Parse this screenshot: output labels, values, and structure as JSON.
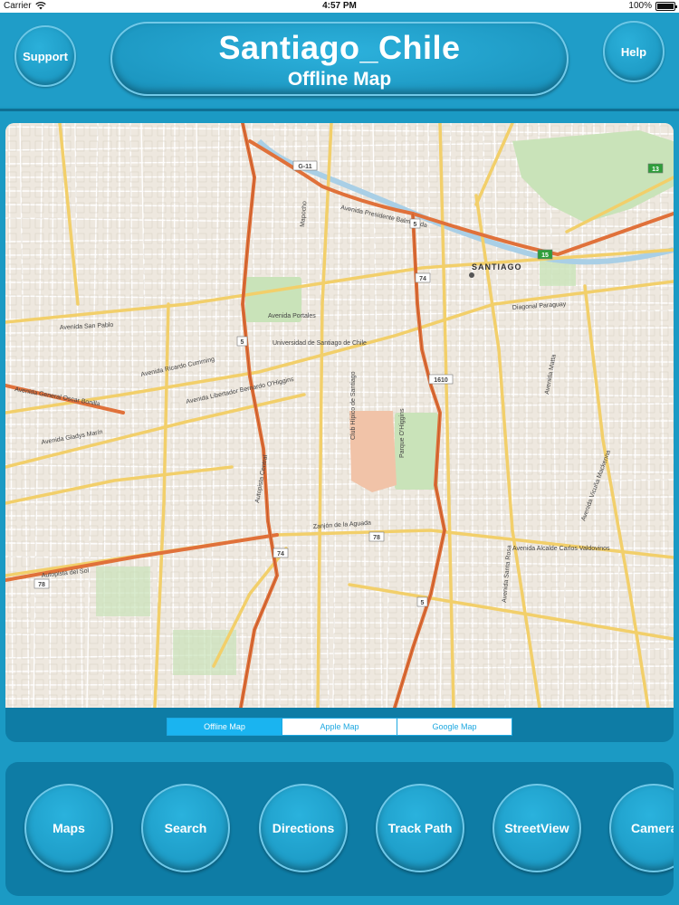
{
  "status_bar": {
    "carrier": "Carrier",
    "time": "4:57 PM",
    "battery": "100%"
  },
  "header": {
    "support_label": "Support",
    "help_label": "Help",
    "title": "Santiago_Chile",
    "subtitle": "Offline Map"
  },
  "map": {
    "city_label": "SANTIAGO",
    "labels": [
      "Avenida San Pablo",
      "Avenida Libertador Bernardo O'Higgins",
      "Avenida General Oscar Bonilla",
      "Avenida Gladys Marín",
      "Parque O'Higgins",
      "Club Hípico de Santiago",
      "Zanjón de la Aguada",
      "Autopista Central",
      "Avenida Santa Rosa",
      "Avenida Vicuña Mackenna",
      "Diagonal Paraguay",
      "Mapocho",
      "Avenida Ricardo Cumming",
      "Avenida Matta",
      "Avenida Portales",
      "Avenida Presidente Balmaceda",
      "Universidad de Santiago de Chile",
      "Avenida Alcalde Carlos Valdovinos",
      "Autopista del Sol"
    ],
    "route_shields": [
      "G-11",
      "5",
      "74",
      "5",
      "1610",
      "78",
      "74",
      "78",
      "5",
      "15",
      "13"
    ]
  },
  "map_type_selector": {
    "options": [
      "Offline Map",
      "Apple Map",
      "Google Map"
    ],
    "selected": "Offline Map"
  },
  "toolbar": {
    "buttons": [
      "Maps",
      "Search",
      "Directions",
      "Track Path",
      "StreetView",
      "Camera"
    ]
  },
  "colors": {
    "background": "#1b9ac4",
    "panel": "#0e7ca5",
    "accent": "#1ab4f0",
    "highway": "#e0713a",
    "major_road": "#f3d06a"
  }
}
